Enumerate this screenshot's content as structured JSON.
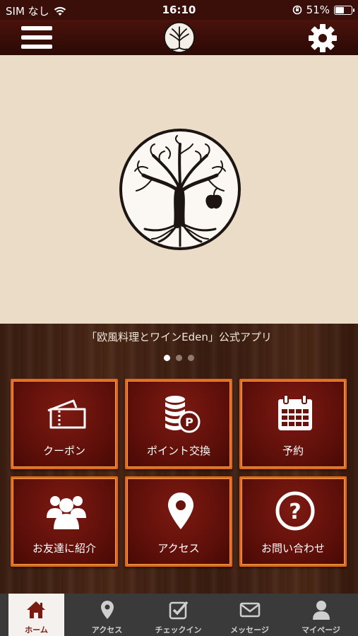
{
  "status_bar": {
    "carrier": "SIM なし",
    "time": "16:10",
    "battery_text": "51%",
    "battery_level": 0.51
  },
  "header": {
    "menu_icon": "hamburger-menu-icon",
    "logo_icon": "tree-of-life-logo",
    "settings_icon": "gear-icon"
  },
  "hero": {
    "logo_icon": "tree-of-life-logo"
  },
  "caption": "「欧風料理とワインEden」公式アプリ",
  "carousel": {
    "page_count": 3,
    "active_index": 0
  },
  "menu": [
    {
      "label": "クーポン",
      "icon": "ticket-icon"
    },
    {
      "label": "ポイント交換",
      "icon": "coins-point-icon"
    },
    {
      "label": "予約",
      "icon": "calendar-icon"
    },
    {
      "label": "お友達に紹介",
      "icon": "users-group-icon"
    },
    {
      "label": "アクセス",
      "icon": "map-pin-icon"
    },
    {
      "label": "お問い合わせ",
      "icon": "question-circle-icon"
    }
  ],
  "tabs": [
    {
      "label": "ホーム",
      "icon": "home-icon",
      "active": true
    },
    {
      "label": "アクセス",
      "icon": "map-pin-icon",
      "active": false
    },
    {
      "label": "チェックイン",
      "icon": "checkbox-icon",
      "active": false
    },
    {
      "label": "メッセージ",
      "icon": "envelope-icon",
      "active": false
    },
    {
      "label": "マイページ",
      "icon": "person-icon",
      "active": false
    }
  ],
  "colors": {
    "header_bg": "#3a0f0a",
    "hero_bg": "#ebdcc8",
    "tile_bg": "#6a130c",
    "tile_border": "#e0691e",
    "tab_bar_bg": "#3b3a3a",
    "tab_active_text": "#7a1a10"
  }
}
